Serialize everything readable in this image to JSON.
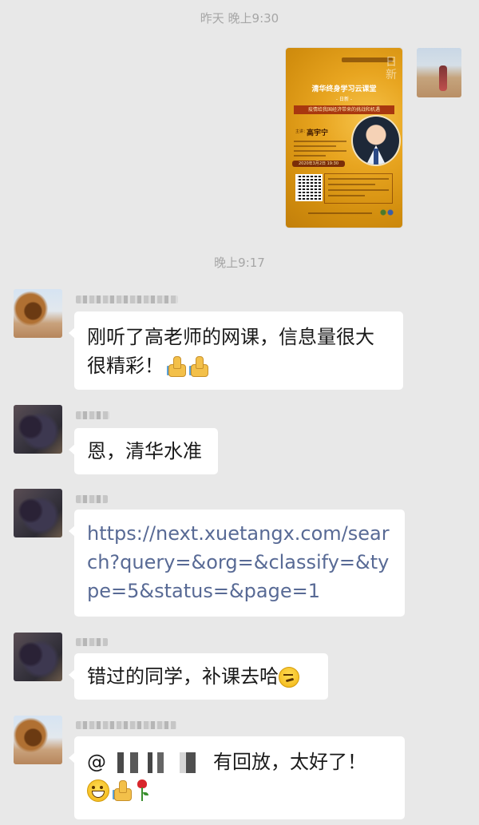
{
  "timestamps": {
    "first": "昨天 晚上9:30",
    "second": "晚上9:17"
  },
  "poster": {
    "title": "清华终身学习云课堂",
    "subtitle": "- 日新 -",
    "topic": "疫情给我国经济带来的挑战和机遇",
    "speaker_label": "主讲：",
    "speaker_name": "高宇宁",
    "date": "2020年3月2日 19:30",
    "corner": "日新"
  },
  "messages": [
    {
      "text": "刚听了高老师的网课，信息量很大很精彩！"
    },
    {
      "text": "恩，清华水准"
    },
    {
      "link": "https://next.xuetangx.com/search?query=&org=&classify=&type=5&status=&page=1"
    },
    {
      "text": "错过的同学，补课去哈"
    },
    {
      "prefix": "@",
      "text": "有回放，太好了！"
    }
  ],
  "icons": {
    "thumbs_up": "thumbs-up-icon",
    "grin": "grin-icon",
    "thinking": "thinking-icon",
    "rose": "rose-icon"
  },
  "colors": {
    "background": "#e8e8e8",
    "bubble": "#ffffff",
    "link": "#586a95",
    "poster_gold": "#e8a520"
  }
}
